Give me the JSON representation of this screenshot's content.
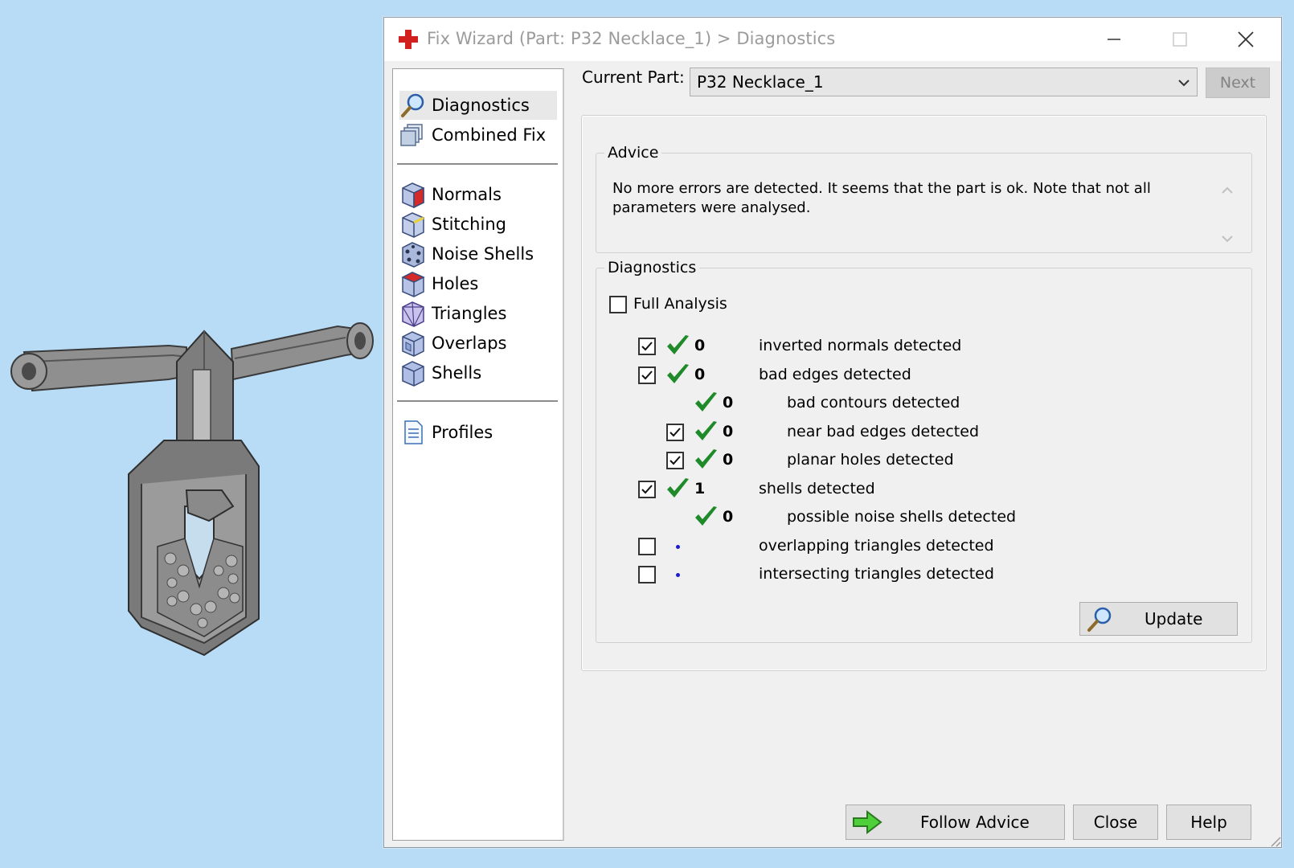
{
  "window": {
    "title": "Fix Wizard (Part: P32 Necklace_1) > Diagnostics"
  },
  "nav": {
    "items": [
      {
        "label": "Diagnostics",
        "icon": "magnifier-icon",
        "selected": true
      },
      {
        "label": "Combined Fix",
        "icon": "combined-fix-icon"
      },
      {
        "label": "Normals",
        "icon": "normals-cube-icon"
      },
      {
        "label": "Stitching",
        "icon": "stitching-cube-icon"
      },
      {
        "label": "Noise Shells",
        "icon": "noise-shells-icon"
      },
      {
        "label": "Holes",
        "icon": "holes-cube-icon"
      },
      {
        "label": "Triangles",
        "icon": "triangles-icon"
      },
      {
        "label": "Overlaps",
        "icon": "overlaps-icon"
      },
      {
        "label": "Shells",
        "icon": "shells-icon"
      },
      {
        "label": "Profiles",
        "icon": "profiles-document-icon"
      }
    ]
  },
  "current_part": {
    "label": "Current Part:",
    "value": "P32 Necklace_1",
    "next_label": "Next"
  },
  "advice": {
    "title": "Advice",
    "text": "No more errors are detected. It seems that the part is ok. Note that not all parameters were analysed."
  },
  "diagnostics": {
    "title": "Diagnostics",
    "full_analysis_label": "Full Analysis",
    "full_analysis_checked": false,
    "rows": [
      {
        "checkbox": true,
        "checked": true,
        "status": "ok",
        "count": "0",
        "label": "inverted normals detected",
        "indent": 0
      },
      {
        "checkbox": true,
        "checked": true,
        "status": "ok",
        "count": "0",
        "label": "bad edges detected",
        "indent": 0
      },
      {
        "checkbox": false,
        "checked": false,
        "status": "ok",
        "count": "0",
        "label": "bad contours detected",
        "indent": 1
      },
      {
        "checkbox": true,
        "checked": true,
        "status": "ok",
        "count": "0",
        "label": "near bad edges detected",
        "indent": 1
      },
      {
        "checkbox": true,
        "checked": true,
        "status": "ok",
        "count": "0",
        "label": "planar holes detected",
        "indent": 1
      },
      {
        "checkbox": true,
        "checked": true,
        "status": "ok",
        "count": "1",
        "label": "shells detected",
        "indent": 0
      },
      {
        "checkbox": false,
        "checked": false,
        "status": "ok",
        "count": "0",
        "label": "possible noise shells detected",
        "indent": 1
      },
      {
        "checkbox": true,
        "checked": false,
        "status": "pending",
        "count": "",
        "label": "overlapping triangles detected",
        "indent": 0
      },
      {
        "checkbox": true,
        "checked": false,
        "status": "pending",
        "count": "",
        "label": "intersecting triangles detected",
        "indent": 0
      }
    ],
    "update_label": "Update"
  },
  "footer": {
    "follow_advice_label": "Follow Advice",
    "close_label": "Close",
    "help_label": "Help"
  },
  "colors": {
    "background": "#b9dcf6",
    "check_green": "#1f8a2a",
    "pending_dot": "#1b1bd0",
    "title_red": "#d21f1f"
  }
}
